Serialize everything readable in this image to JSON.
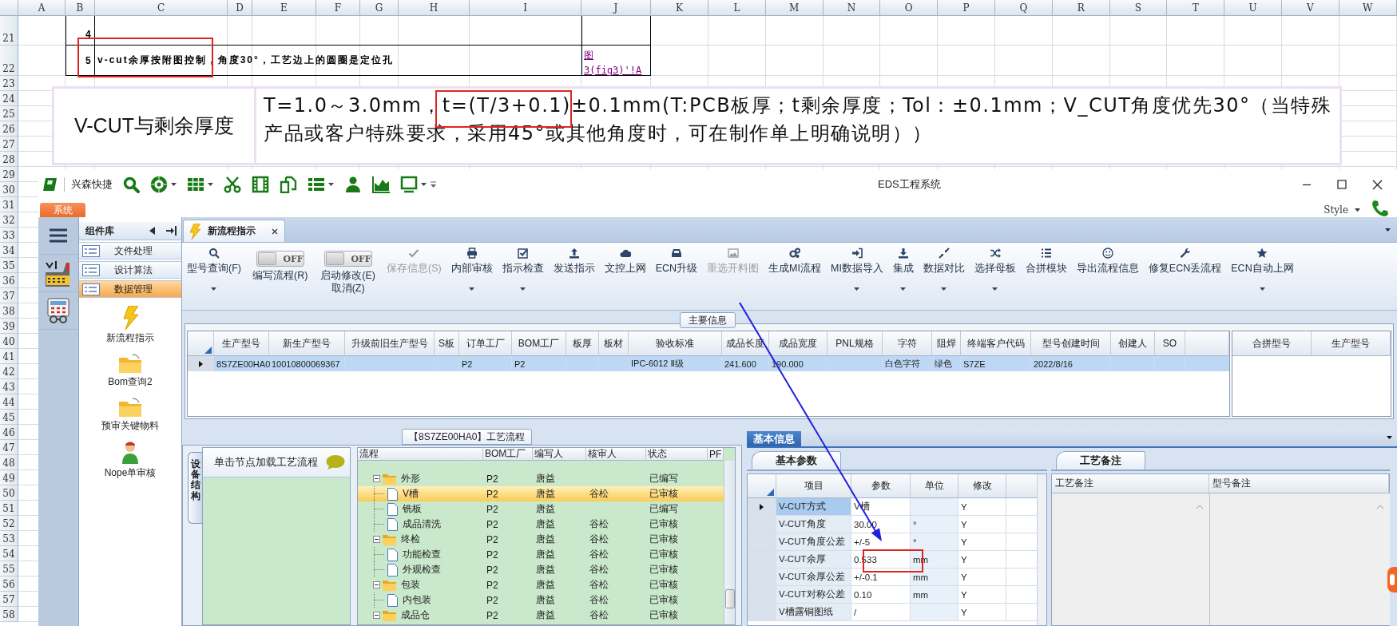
{
  "spreadsheet": {
    "columns": [
      "A",
      "B",
      "C",
      "D",
      "E",
      "F",
      "G",
      "H",
      "I",
      "J",
      "K",
      "L",
      "M",
      "N",
      "O",
      "P",
      "Q",
      "R",
      "S",
      "T",
      "U",
      "V",
      "W"
    ],
    "rows": [
      {
        "number": "21",
        "item_no": "4"
      },
      {
        "number": "22",
        "item_no": "5",
        "description": "v-cut余厚按附图控制，角度30°，工艺边上的圆圈是定位孔",
        "link": [
          "图",
          "3(fig3)'!A"
        ]
      },
      {
        "number": "23"
      },
      {
        "number": "24"
      },
      {
        "number": "25"
      },
      {
        "number": "26"
      },
      {
        "number": "27"
      },
      {
        "number": "28"
      },
      {
        "number": "29"
      },
      {
        "number": "30"
      },
      {
        "number": "31"
      },
      {
        "number": "32"
      },
      {
        "number": "33"
      },
      {
        "number": "34"
      },
      {
        "number": "35"
      },
      {
        "number": "36"
      },
      {
        "number": "37"
      },
      {
        "number": "38"
      },
      {
        "number": "39"
      },
      {
        "number": "40"
      },
      {
        "number": "41"
      },
      {
        "number": "42"
      },
      {
        "number": "43"
      },
      {
        "number": "44"
      },
      {
        "number": "45"
      },
      {
        "number": "46"
      },
      {
        "number": "47"
      },
      {
        "number": "48"
      },
      {
        "number": "49"
      },
      {
        "number": "50"
      },
      {
        "number": "51"
      },
      {
        "number": "52"
      },
      {
        "number": "53"
      },
      {
        "number": "54"
      },
      {
        "number": "55"
      },
      {
        "number": "56"
      },
      {
        "number": "57"
      },
      {
        "number": "58"
      }
    ]
  },
  "note_box": {
    "label": "V-CUT与剩余厚度",
    "text": "T=1.0～3.0mm，t=(T/3+0.1)±0.1mm(T:PCB板厚；t剩余厚度；Tol：±0.1mm；V_CUT角度优先30°（当特殊产品或客户特殊要求，采用45°或其他角度时，可在制作单上明确说明））"
  },
  "window": {
    "app_name": "兴森快捷",
    "title": "EDS工程系统",
    "menu_tab": "系统",
    "style_menu": "Style"
  },
  "nav_panel": {
    "header": "组件库",
    "groups": [
      {
        "label": "文件处理",
        "selected": false
      },
      {
        "label": "设计算法",
        "selected": false
      },
      {
        "label": "数据管理",
        "selected": true
      }
    ],
    "launchers": [
      {
        "label": "新流程指示"
      },
      {
        "label": "Bom查询2"
      },
      {
        "label": "预审关键物料"
      },
      {
        "label": "Nope单审核"
      }
    ]
  },
  "document_tab": {
    "label": "新流程指示"
  },
  "ribbon": [
    {
      "kind": "button",
      "lines": [
        "型号查询(F)"
      ],
      "dropdown": true,
      "disabled": false
    },
    {
      "kind": "toggle",
      "switch": "OFF",
      "on": false,
      "lines": [
        "编写流程(R)"
      ]
    },
    {
      "kind": "toggle",
      "switch": "OFF",
      "on": false,
      "lines": [
        "启动修改(E)",
        "取消(Z)"
      ]
    },
    {
      "kind": "button",
      "lines": [
        "保存信息(S)"
      ],
      "dropdown": false,
      "disabled": true
    },
    {
      "kind": "button",
      "lines": [
        "内部审核"
      ],
      "dropdown": true,
      "disabled": false
    },
    {
      "kind": "button",
      "lines": [
        "指示检查"
      ],
      "dropdown": true,
      "disabled": false
    },
    {
      "kind": "button",
      "lines": [
        "发送指示"
      ],
      "dropdown": false,
      "disabled": false
    },
    {
      "kind": "button",
      "lines": [
        "文控上网"
      ],
      "dropdown": false,
      "disabled": false
    },
    {
      "kind": "button",
      "lines": [
        "ECN升级"
      ],
      "dropdown": false,
      "disabled": false
    },
    {
      "kind": "button",
      "lines": [
        "重选开料图"
      ],
      "dropdown": false,
      "disabled": true
    },
    {
      "kind": "button",
      "lines": [
        "生成MI流程"
      ],
      "dropdown": false,
      "disabled": false
    },
    {
      "kind": "button",
      "lines": [
        "MI数据导入"
      ],
      "dropdown": true,
      "disabled": false
    },
    {
      "kind": "button",
      "lines": [
        "集成"
      ],
      "dropdown": true,
      "disabled": false
    },
    {
      "kind": "button",
      "lines": [
        "数据对比"
      ],
      "dropdown": true,
      "disabled": false
    },
    {
      "kind": "button",
      "lines": [
        "选择母板"
      ],
      "dropdown": true,
      "disabled": false
    },
    {
      "kind": "button",
      "lines": [
        "合拼模块"
      ],
      "dropdown": false,
      "disabled": false
    },
    {
      "kind": "button",
      "lines": [
        "导出流程信息"
      ],
      "dropdown": false,
      "disabled": false
    },
    {
      "kind": "button",
      "lines": [
        "修复ECN丢流程"
      ],
      "dropdown": false,
      "disabled": false
    },
    {
      "kind": "button",
      "lines": [
        "ECN自动上网"
      ],
      "dropdown": true,
      "disabled": false
    }
  ],
  "main_info": {
    "title": "主要信息",
    "columns": [
      "生产型号",
      "新生产型号",
      "升级前旧生产型号",
      "S板",
      "订单工厂",
      "BOM工厂",
      "板厚",
      "板材",
      "验收标准",
      "成品长度",
      "成品宽度",
      "PNL规格",
      "字符",
      "阻焊",
      "终端客户代码",
      "型号创建时间",
      "创建人",
      "SO"
    ],
    "rows": [
      {
        "selected": true,
        "cells": [
          "8S7ZE00HA0",
          "10010800069367",
          null,
          null,
          "P2",
          "P2",
          null,
          null,
          "IPC-6012 Ⅱ级",
          "241.600",
          "190.000",
          null,
          "白色字符",
          "绿色",
          "S7ZE",
          "2022/8/16",
          null,
          null
        ]
      }
    ],
    "side_columns": [
      "合拼型号",
      "生产型号"
    ]
  },
  "process_flow": {
    "title": "【8S7ZE00HA0】工艺流程",
    "side_tab": "设备结构",
    "hint": "单击节点加载工艺流程",
    "columns": [
      "流程",
      "BOM工厂",
      "编写人",
      "核审人",
      "状态",
      "PF"
    ],
    "rows": [
      {
        "name": "外形",
        "factory": "P2",
        "writer": "唐益",
        "status": "已编写",
        "expanded": true,
        "selected": false,
        "children": [
          {
            "name": "V槽",
            "factory": "P2",
            "writer": "唐益",
            "reviewer": "谷松",
            "status": "已审核",
            "selected": true
          },
          {
            "name": "铣板",
            "factory": "P2",
            "writer": "唐益",
            "status": "已编写",
            "selected": false
          },
          {
            "name": "成品清洗",
            "factory": "P2",
            "writer": "唐益",
            "reviewer": "谷松",
            "status": "已审核",
            "selected": false
          }
        ]
      },
      {
        "name": "终检",
        "factory": "P2",
        "writer": "唐益",
        "reviewer": "谷松",
        "status": "已审核",
        "expanded": true,
        "selected": false,
        "children": [
          {
            "name": "功能检查",
            "factory": "P2",
            "writer": "唐益",
            "reviewer": "谷松",
            "status": "已审核",
            "selected": false
          },
          {
            "name": "外观检查",
            "factory": "P2",
            "writer": "唐益",
            "reviewer": "谷松",
            "status": "已审核",
            "selected": false
          }
        ]
      },
      {
        "name": "包装",
        "factory": "P2",
        "writer": "唐益",
        "reviewer": "谷松",
        "status": "已审核",
        "expanded": true,
        "selected": false,
        "children": [
          {
            "name": "内包装",
            "factory": "P2",
            "writer": "唐益",
            "reviewer": "谷松",
            "status": "已审核",
            "selected": false
          }
        ]
      },
      {
        "name": "成品仓",
        "factory": "P2",
        "writer": "唐益",
        "reviewer": "谷松",
        "status": "已审核",
        "expanded": true,
        "selected": false
      }
    ]
  },
  "basic_info": {
    "tab": "基本信息",
    "params": {
      "tab": "基本参数",
      "columns": [
        "项目",
        "参数",
        "单位",
        "修改"
      ],
      "rows": [
        {
          "item": "V-CUT方式",
          "value": "V槽",
          "modify": "Y",
          "selected": true
        },
        {
          "item": "V-CUT角度",
          "value": "30.00",
          "unit": "°",
          "modify": "Y",
          "selected": false
        },
        {
          "item": "V-CUT角度公差",
          "value": "+/-5",
          "unit": "°",
          "modify": "Y",
          "selected": false
        },
        {
          "item": "V-CUT余厚",
          "value": "0.533",
          "unit": "mm",
          "modify": "Y",
          "selected": false
        },
        {
          "item": "V-CUT余厚公差",
          "value": "+/-0.1",
          "unit": "mm",
          "modify": "Y",
          "selected": false
        },
        {
          "item": "V-CUT对称公差",
          "value": "0.10",
          "unit": "mm",
          "modify": "Y",
          "selected": false
        },
        {
          "item": "V槽露铜图纸",
          "value": "/",
          "modify": "Y",
          "selected": false
        }
      ]
    },
    "notes": {
      "tab": "工艺备注",
      "columns": [
        "工艺备注",
        "型号备注"
      ]
    }
  },
  "annotations": [
    {
      "kind": "rectangle",
      "color": "#e02424"
    },
    {
      "kind": "rectangle",
      "color": "#e02424"
    },
    {
      "kind": "arrow",
      "color": "#1f1fe0"
    },
    {
      "kind": "rectangle",
      "color": "#e02424"
    }
  ]
}
